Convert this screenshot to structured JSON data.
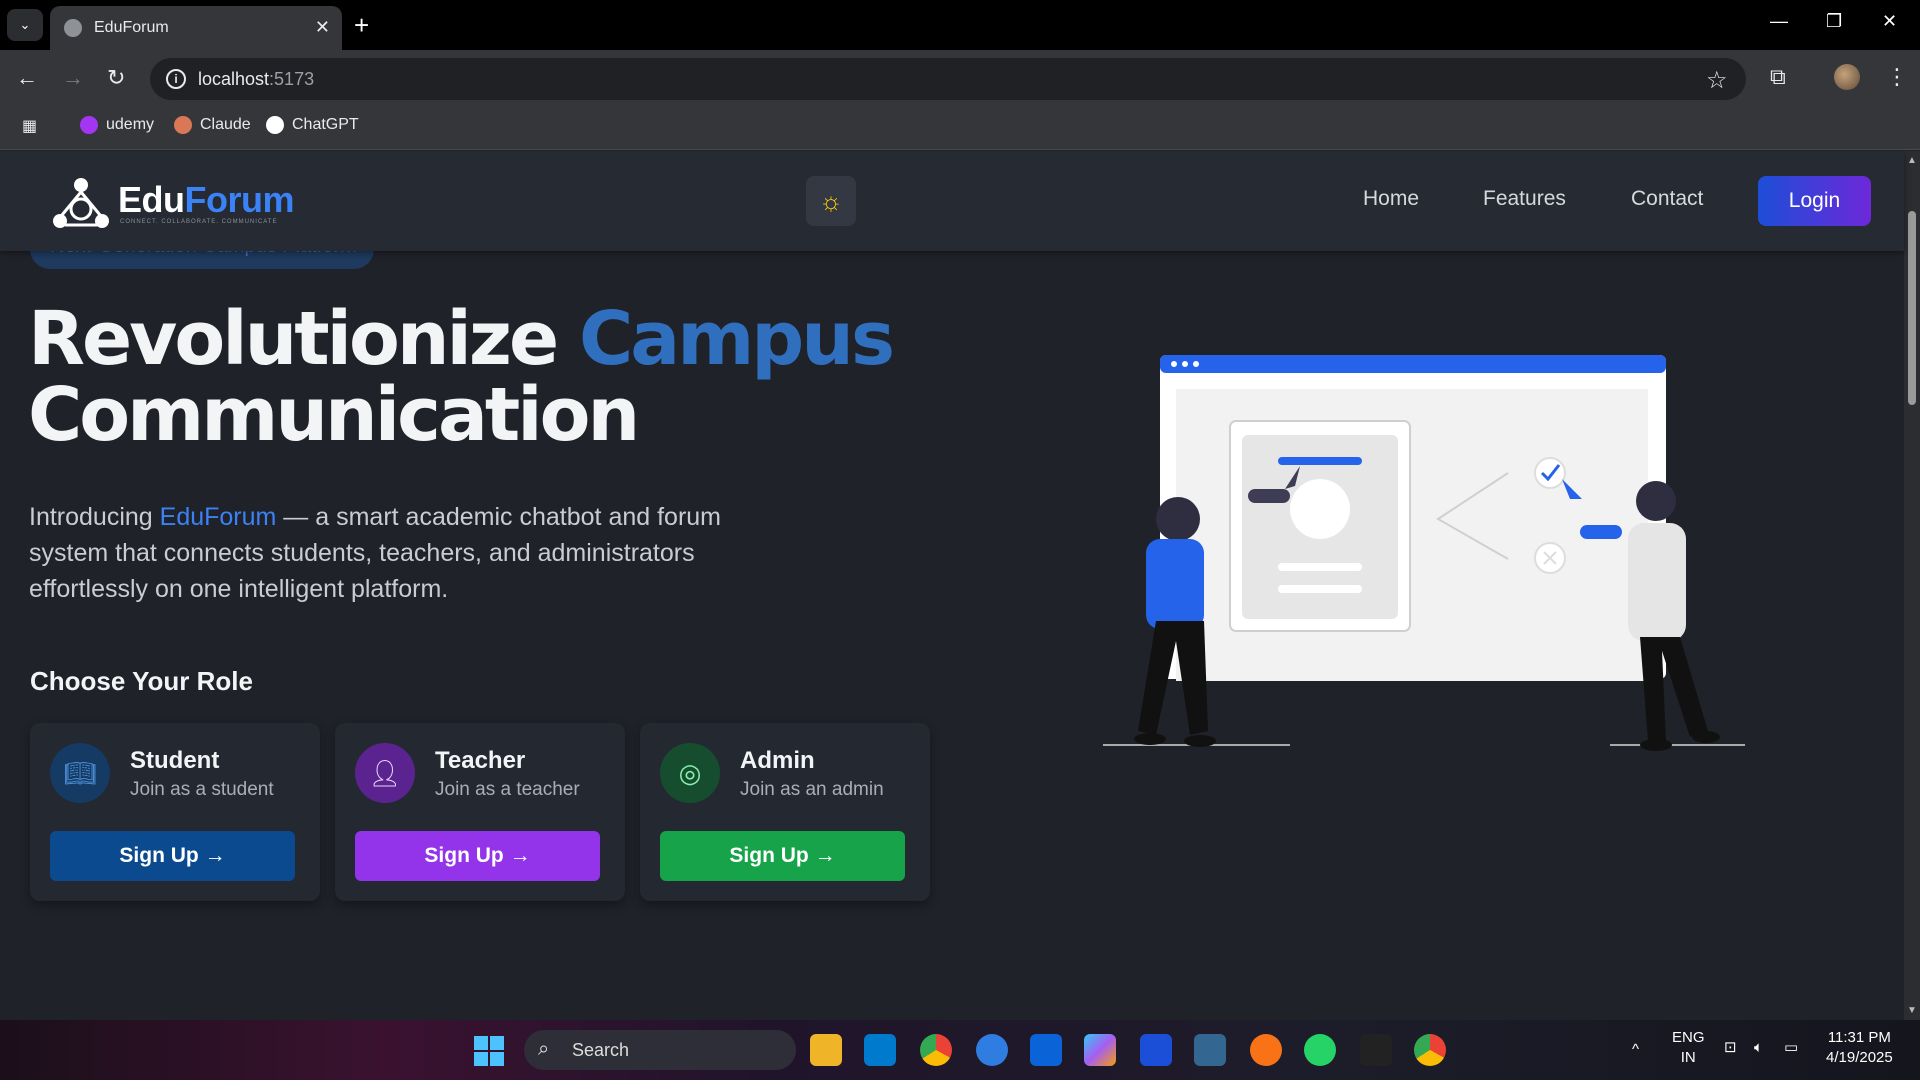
{
  "browser": {
    "tab_title": "EduForum",
    "url_host": "localhost",
    "url_port": ":5173",
    "bookmarks": [
      "udemy",
      "Claude",
      "ChatGPT"
    ]
  },
  "nav": {
    "logo_prefix": "Edu",
    "logo_accent": "Forum",
    "logo_tagline": "CONNECT. COLLABORATE. COMMUNICATE",
    "links": [
      "Home",
      "Features",
      "Contact"
    ],
    "login": "Login"
  },
  "hero": {
    "badge": "Next-Generation Campus Platform",
    "title_part1": "Revolutionize ",
    "title_accent": "Campus",
    "title_part2": "Communication",
    "intro_before": "Introducing ",
    "intro_brand": "EduForum",
    "intro_after": " — a smart academic chatbot and forum system that connects students, teachers, and administrators effortlessly on one intelligent platform."
  },
  "roles": {
    "heading": "Choose Your Role",
    "cards": [
      {
        "title": "Student",
        "subtitle": "Join as a student",
        "button": "Sign Up →",
        "color": "#0b4a8f",
        "icon_bg": "#153a63",
        "icon_color": "#4d8fd6",
        "icon": "book-icon"
      },
      {
        "title": "Teacher",
        "subtitle": "Join as a teacher",
        "button": "Sign Up →",
        "color": "#9333ea",
        "icon_bg": "#5b2390",
        "icon_color": "#e9d5ff",
        "icon": "user-icon"
      },
      {
        "title": "Admin",
        "subtitle": "Join as an admin",
        "button": "Sign Up →",
        "color": "#16a34a",
        "icon_bg": "#174d2f",
        "icon_color": "#86efac",
        "icon": "admin-icon"
      }
    ]
  },
  "taskbar": {
    "search": "Search",
    "lang1": "ENG",
    "lang2": "IN",
    "time": "11:31 PM",
    "date": "4/19/2025"
  }
}
